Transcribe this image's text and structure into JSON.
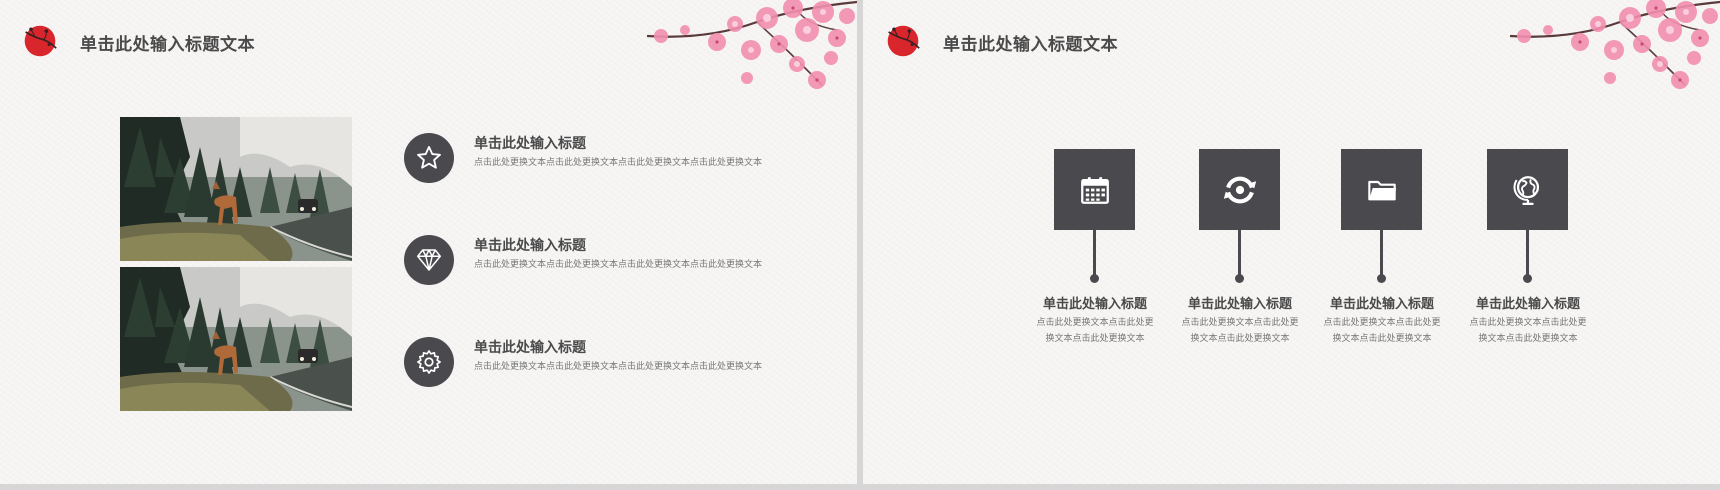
{
  "slide1": {
    "title": "单击此处输入标题文本",
    "items": [
      {
        "icon": "star-icon",
        "title": "单击此处输入标题",
        "desc": "点击此处更换文本点击此处更换文本点击此处更换文本点击此处更换文本"
      },
      {
        "icon": "diamond-icon",
        "title": "单击此处输入标题",
        "desc": "点击此处更换文本点击此处更换文本点击此处更换文本点击此处更换文本"
      },
      {
        "icon": "gear-icon",
        "title": "单击此处输入标题",
        "desc": "点击此处更换文本点击此处更换文本点击此处更换文本点击此处更换文本"
      }
    ]
  },
  "slide2": {
    "title": "单击此处输入标题文本",
    "features": [
      {
        "icon": "calendar-icon",
        "title": "单击此处输入标题",
        "desc": "点击此处更换文本点击此处更换文本点击此处更换文本"
      },
      {
        "icon": "refresh-icon",
        "title": "单击此处输入标题",
        "desc": "点击此处更换文本点击此处更换文本点击此处更换文本"
      },
      {
        "icon": "folder-icon",
        "title": "单击此处输入标题",
        "desc": "点击此处更换文本点击此处更换文本点击此处更换文本"
      },
      {
        "icon": "globe-icon",
        "title": "单击此处输入标题",
        "desc": "点击此处更换文本点击此处更换文本点击此处更换文本"
      }
    ]
  },
  "colors": {
    "dark": "#4a4a4e",
    "text": "#4a4a4a",
    "muted": "#777777",
    "accent_red": "#d9262c",
    "blossom_pink": "#f28fb0"
  }
}
